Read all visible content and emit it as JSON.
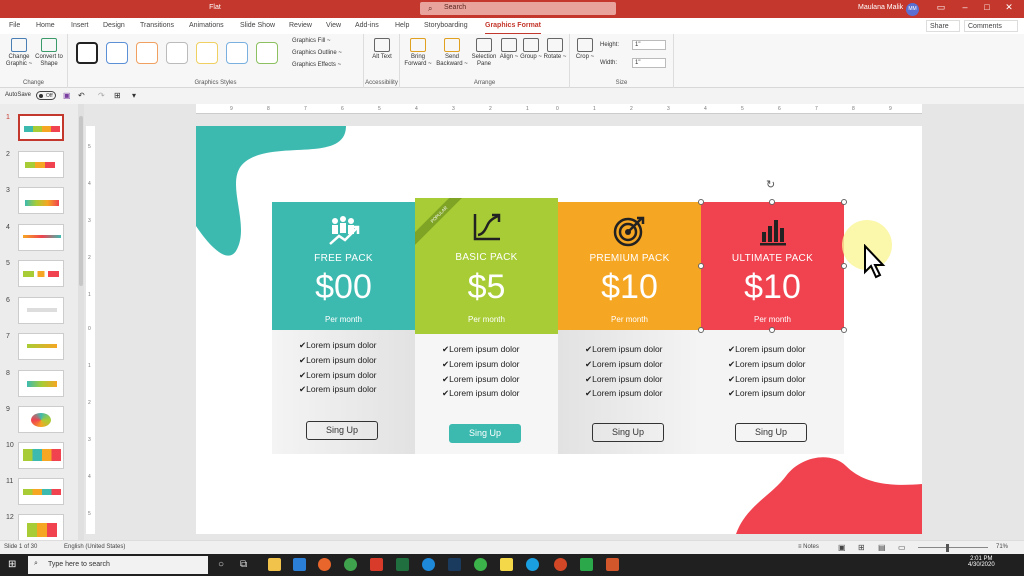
{
  "titlebar": {
    "title": "Flat",
    "search": "Search",
    "user": "Maulana Malik",
    "initials": "MM",
    "btn_min": "–",
    "btn_max": "□",
    "btn_close": "✕",
    "btn_ribbon": "▭"
  },
  "tabs": [
    "File",
    "Home",
    "Insert",
    "Design",
    "Transitions",
    "Animations",
    "Slide Show",
    "Review",
    "View",
    "Add-ins",
    "Help",
    "Storyboarding",
    "Graphics Format"
  ],
  "share_label": "Share",
  "comments_label": "Comments",
  "ribbon": {
    "change": {
      "label": "Change",
      "btn1": "Change Graphic ~",
      "btn2": "Convert to Shape"
    },
    "styles": {
      "label": "Graphics Styles",
      "fill": "Graphics Fill ~",
      "outline": "Graphics Outline ~",
      "effects": "Graphics Effects ~"
    },
    "access": {
      "label": "Accessibility",
      "alt": "Alt Text"
    },
    "arrange": {
      "label": "Arrange",
      "bring": "Bring Forward ~",
      "send": "Send Backward ~",
      "selection": "Selection Pane",
      "align": "Align ~",
      "group": "Group ~",
      "rotate": "Rotate ~"
    },
    "size": {
      "label": "Size",
      "crop": "Crop ~",
      "height_label": "Height:",
      "height_val": "1\"",
      "width_label": "Width:",
      "width_val": "1\""
    }
  },
  "quickbar": {
    "autosave": "AutoSave",
    "toggle": "Off"
  },
  "thumb_numbers": [
    "1",
    "2",
    "3",
    "4",
    "5",
    "6",
    "7",
    "8",
    "9",
    "10",
    "11",
    "12"
  ],
  "ruler_h": [
    "9",
    "8",
    "7",
    "6",
    "5",
    "4",
    "3",
    "2",
    "1",
    "0",
    "1",
    "2",
    "3",
    "4",
    "5",
    "6",
    "7",
    "8",
    "9"
  ],
  "ruler_v": [
    "5",
    "4",
    "3",
    "2",
    "1",
    "0",
    "1",
    "2",
    "3",
    "4",
    "5"
  ],
  "colors": {
    "teal": "#3dbab0",
    "green": "#a8cc35",
    "orange": "#f5a623",
    "red": "#f0424f",
    "accent": "#c4372c"
  },
  "cards": [
    {
      "name": "FREE PACK",
      "price": "$00",
      "per": "Per month",
      "features": [
        "✔Lorem ipsum dolor",
        "✔Lorem ipsum dolor",
        "✔Lorem ipsum dolor",
        "✔Lorem ipsum dolor"
      ],
      "button": "Sing Up",
      "icon": "team-growth-icon"
    },
    {
      "name": "BASIC PACK",
      "price": "$5",
      "per": "Per month",
      "features": [
        "✔Lorem ipsum dolor",
        "✔Lorem ipsum dolor",
        "✔Lorem ipsum dolor",
        "✔Lorem ipsum dolor"
      ],
      "button": "Sing Up",
      "badge": "POPULAR",
      "icon": "trend-chart-icon"
    },
    {
      "name": "PREMIUM PACK",
      "price": "$10",
      "per": "Per month",
      "features": [
        "✔Lorem ipsum dolor",
        "✔Lorem ipsum dolor",
        "✔Lorem ipsum dolor",
        "✔Lorem ipsum dolor"
      ],
      "button": "Sing Up",
      "icon": "target-icon"
    },
    {
      "name": "ULTIMATE PACK",
      "price": "$10",
      "per": "Per month",
      "features": [
        "✔Lorem ipsum dolor",
        "✔Lorem ipsum dolor",
        "✔Lorem ipsum dolor",
        "✔Lorem ipsum dolor"
      ],
      "button": "Sing Up",
      "icon": "bar-chart-icon"
    }
  ],
  "status": {
    "slide": "Slide 1 of 30",
    "language": "English (United States)",
    "notes": "Notes",
    "zoom": "71%"
  },
  "taskbar": {
    "search": "Type here to search",
    "time": "2:01 PM",
    "date": "4/30/2020"
  }
}
